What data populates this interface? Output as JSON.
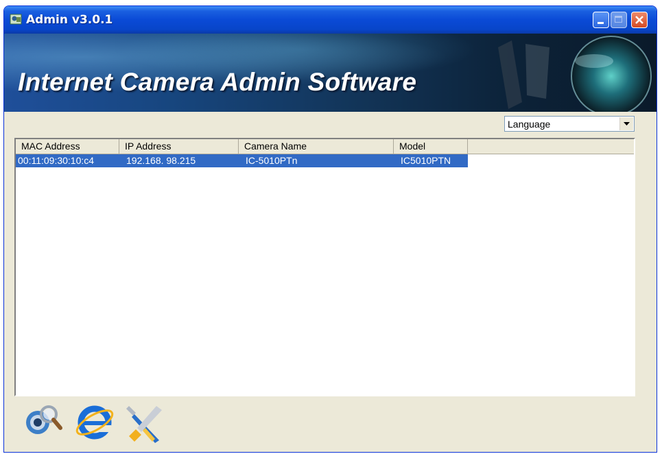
{
  "window": {
    "title": "Admin v3.0.1"
  },
  "banner": {
    "title": "Internet Camera Admin Software"
  },
  "language": {
    "selected": "Language"
  },
  "table": {
    "columns": [
      "MAC Address",
      "IP Address",
      "Camera Name",
      "Model"
    ],
    "rows": [
      {
        "mac": "00:11:09:30:10:c4",
        "ip": "192.168. 98.215",
        "name": "IC-5010PTn",
        "model": "IC5010PTN",
        "selected": true
      }
    ]
  },
  "toolbar": {
    "icons": [
      "search-camera-icon",
      "internet-explorer-icon",
      "settings-tools-icon"
    ]
  },
  "colors": {
    "titlebar": "#0a4ad6",
    "selection": "#316ac5",
    "window_bg": "#ece9d8"
  }
}
